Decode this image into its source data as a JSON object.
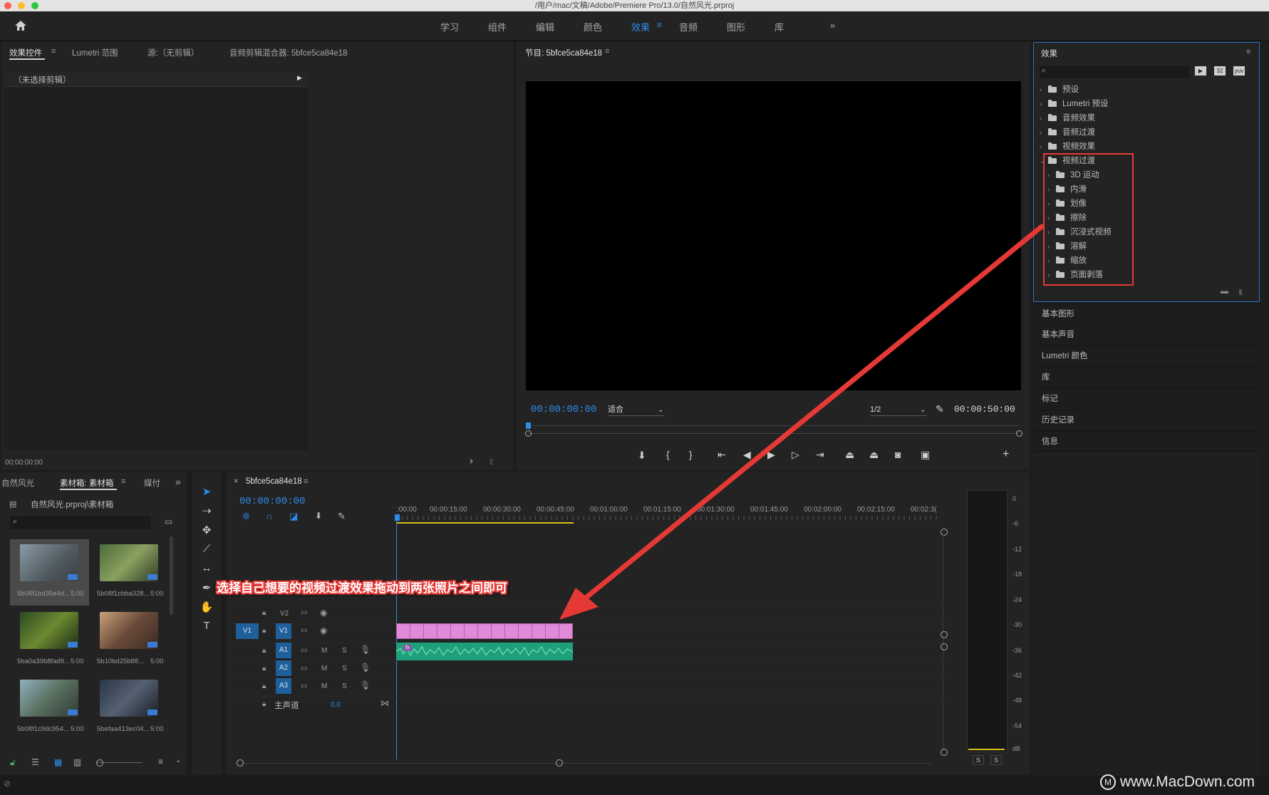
{
  "window": {
    "title": "/用户/mac/文稿/Adobe/Premiere Pro/13.0/自然风光.prproj"
  },
  "workspaces": [
    "学习",
    "组件",
    "编辑",
    "颜色",
    "效果",
    "音频",
    "图形",
    "库"
  ],
  "workspace_more": "»",
  "effect_controls": {
    "tabs": [
      "效果控件",
      "Lumetri 范围",
      "源:（无剪辑）",
      "音频剪辑混合器: 5bfce5ca84e18"
    ],
    "no_clip": "（未选择剪辑）",
    "timecode": "00:00:00:00"
  },
  "program": {
    "title": "节目: 5bfce5ca84e18",
    "timecode": "00:00:00:00",
    "fit": "适合",
    "resolution": "1/2",
    "duration": "00:00:50:00"
  },
  "effects": {
    "title": "效果",
    "items": [
      "预设",
      "Lumetri 预设",
      "音频效果",
      "音频过渡",
      "视频效果",
      "视频过渡"
    ],
    "subitems": [
      "3D 运动",
      "内滑",
      "划像",
      "擦除",
      "沉浸式视频",
      "溶解",
      "缩放",
      "页面剥落"
    ]
  },
  "side_panels": [
    "基本图形",
    "基本声音",
    "Lumetri 颜色",
    "库",
    "标记",
    "历史记录",
    "信息"
  ],
  "project": {
    "tabs": [
      "自然风光",
      "素材箱: 素材箱",
      "媒付"
    ],
    "path": "自然风光.prproj\\素材箱",
    "clips": [
      {
        "name": "5b08f1bd35e4d...",
        "dur": "5:00"
      },
      {
        "name": "5b08f1cbba328...",
        "dur": "5:00"
      },
      {
        "name": "5ba0a39b8fad9...",
        "dur": "5:00"
      },
      {
        "name": "5b10bd25b88...",
        "dur": "5:00"
      },
      {
        "name": "5b08f1c9dc954...",
        "dur": "5:00"
      },
      {
        "name": "5befaa413ec04...",
        "dur": "5:00"
      }
    ]
  },
  "timeline": {
    "title": "5bfce5ca84e18",
    "timecode": "00:00:00:00",
    "ruler": [
      ":00:00",
      "00:00:15:00",
      "00:00:30:00",
      "00:00:45:00",
      "00:01:00:00",
      "00:01:15:00",
      "00:01:30:00",
      "00:01:45:00",
      "00:02:00:00",
      "00:02:15:00",
      "00:02:3("
    ],
    "tracks": {
      "v2": "V2",
      "v1": "V1",
      "v1_src": "V1",
      "a1": "A1",
      "a2": "A2",
      "a3": "A3",
      "m": "M",
      "s": "S",
      "master": "主声道",
      "master_val": "0.0"
    }
  },
  "annotation": {
    "text": "选择自己想要的视频过渡效果拖动到两张照片之间即可"
  },
  "meter": {
    "labels": [
      "0",
      "-6",
      "-12",
      "-18",
      "-24",
      "-30",
      "-36",
      "-42",
      "-48",
      "-54",
      "dB"
    ],
    "solo": "S"
  },
  "watermark": "www.MacDown.com",
  "colors": {
    "accent": "#2d8ceb",
    "clip_video": "#e08ad9",
    "clip_audio": "#1fa07a",
    "highlight": "#e53935"
  }
}
